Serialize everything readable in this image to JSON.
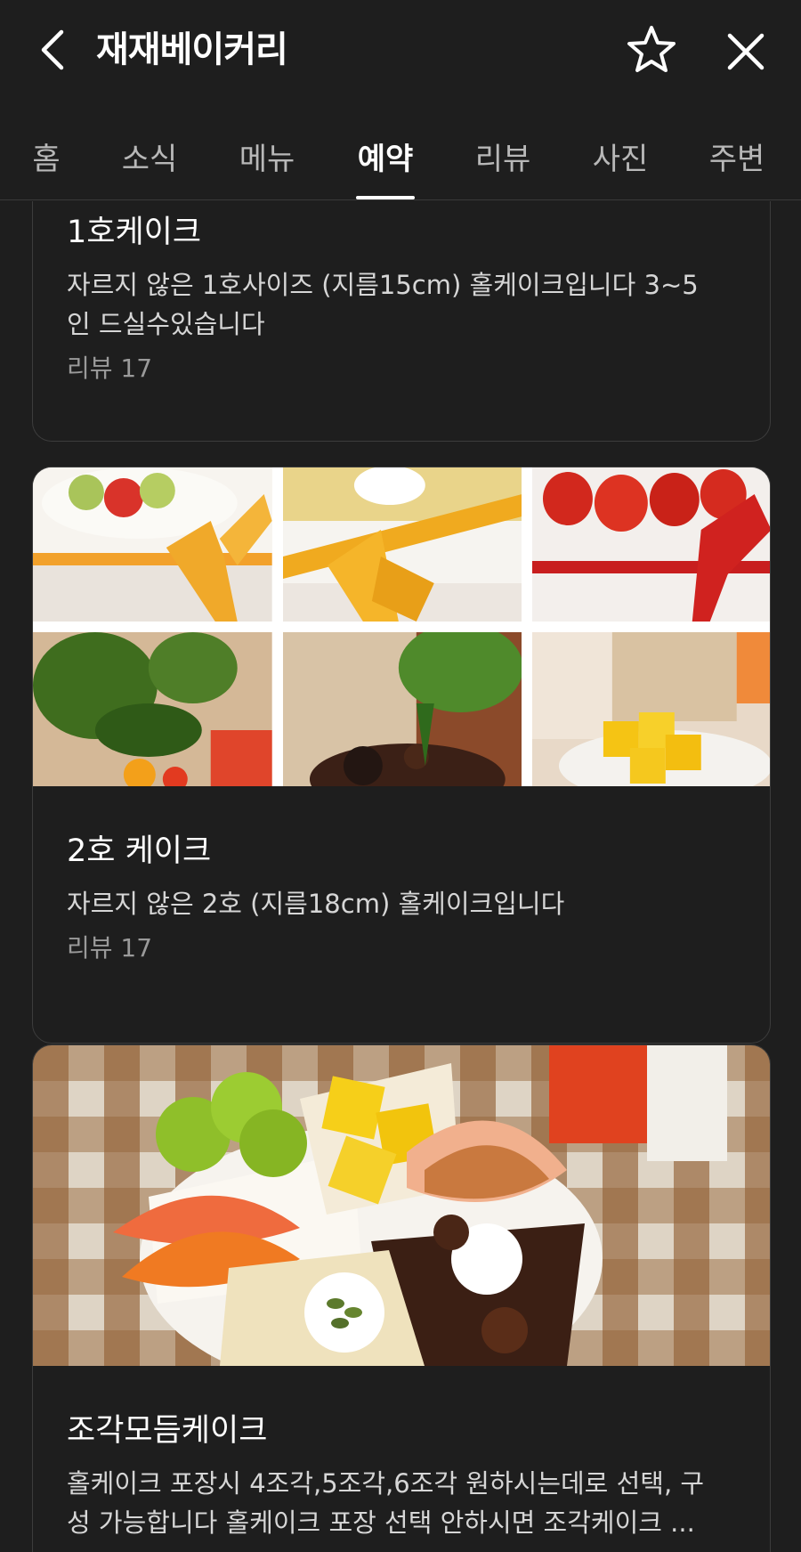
{
  "header": {
    "title": "재재베이커리"
  },
  "tabs": [
    {
      "label": "홈",
      "active": false
    },
    {
      "label": "소식",
      "active": false
    },
    {
      "label": "메뉴",
      "active": false
    },
    {
      "label": "예약",
      "active": true
    },
    {
      "label": "리뷰",
      "active": false
    },
    {
      "label": "사진",
      "active": false
    },
    {
      "label": "주변",
      "active": false
    }
  ],
  "items": [
    {
      "title": "1호케이크",
      "description_line1": "자르지 않은 1호사이즈 (지름15cm) 홀케이크입니다 3~5",
      "description_line2": "인 드실수있습니다",
      "reviews": "리뷰 17"
    },
    {
      "title": "2호 케이크",
      "description_line1": "자르지 않은 2호 (지름18cm) 홀케이크입니다",
      "reviews": "리뷰 17"
    },
    {
      "title": "조각모듬케이크",
      "description_line1": "홀케이크 포장시 4조각,5조각,6조각 원하시는데로 선택, 구",
      "description_line2": "성 가능합니다 홀케이크 포장 선택 안하시면 조각케이크 ..."
    }
  ],
  "colors": {
    "background": "#1e1e1e",
    "card_border": "#3c3c3c",
    "text_primary": "#ffffff",
    "text_secondary": "#d6d6d6",
    "text_muted": "#9a9a9a"
  }
}
